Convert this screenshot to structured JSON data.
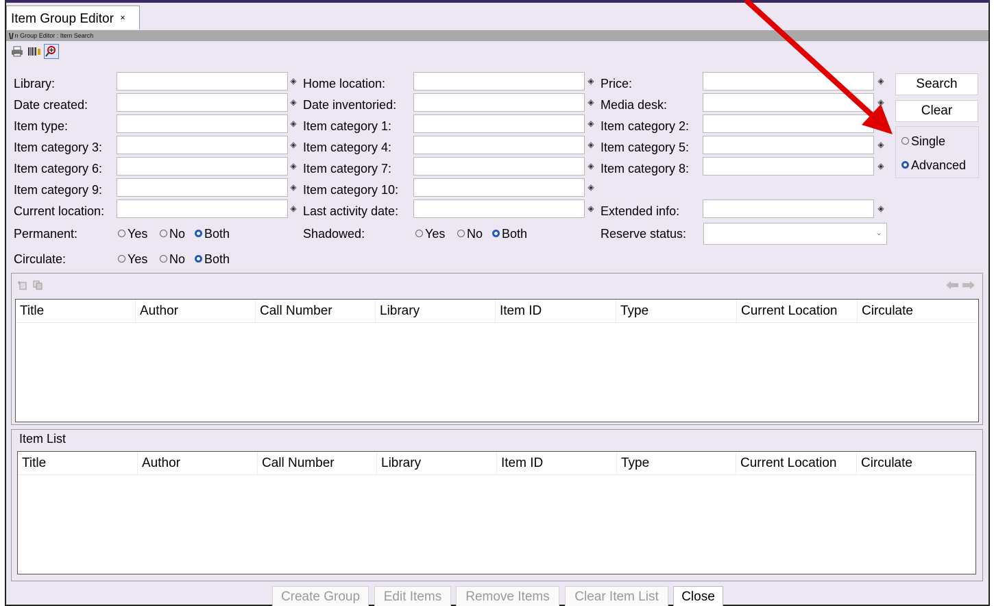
{
  "window": {
    "tab_title": "Item Group Editor",
    "tab_close": "×",
    "breadcrumb_lead": "\\/",
    "breadcrumb": "n Group Editor : Item Search"
  },
  "fields": {
    "library": "Library:",
    "home_location": "Home location:",
    "price": "Price:",
    "date_created": "Date created:",
    "date_inventoried": "Date inventoried:",
    "media_desk": "Media desk:",
    "item_type": "Item type:",
    "item_category_1": "Item category 1:",
    "item_category_2": "Item category 2:",
    "item_category_3": "Item category 3:",
    "item_category_4": "Item category 4:",
    "item_category_5": "Item category 5:",
    "item_category_6": "Item category 6:",
    "item_category_7": "Item category 7:",
    "item_category_8": "Item category 8:",
    "item_category_9": "Item category 9:",
    "item_category_10": "Item category 10:",
    "current_location": "Current location:",
    "last_activity_date": "Last activity date:",
    "extended_info": "Extended info:",
    "permanent": "Permanent:",
    "shadowed": "Shadowed:",
    "reserve_status": "Reserve status:",
    "circulate": "Circulate:",
    "reserve_status_value": ""
  },
  "radio_options": {
    "yes": "Yes",
    "no": "No",
    "both": "Both",
    "selected": "Both"
  },
  "actions": {
    "search": "Search",
    "clear": "Clear"
  },
  "search_mode": {
    "single": "Single",
    "advanced": "Advanced",
    "selected": "Advanced"
  },
  "results_table": {
    "columns": [
      "Title",
      "Author",
      "Call Number",
      "Library",
      "Item ID",
      "Type",
      "Current Location",
      "Circulate"
    ],
    "rows": []
  },
  "item_list": {
    "legend": "Item List",
    "columns": [
      "Title",
      "Author",
      "Call Number",
      "Library",
      "Item ID",
      "Type",
      "Current Location",
      "Circulate"
    ],
    "rows": []
  },
  "bottom_buttons": {
    "create_group": "Create Group",
    "edit_items": "Edit Items",
    "remove_items": "Remove Items",
    "clear_item_list": "Clear Item List",
    "close": "Close"
  },
  "colors": {
    "annotation_arrow": "#e00000",
    "radio_selected": "#1f5bb8",
    "panel_bg": "#ede7f3"
  },
  "icons": [
    "printer-icon",
    "barcode-icon",
    "item-search-icon",
    "spinner-icon",
    "chevron-down-icon",
    "add-row-icon",
    "copy-row-icon",
    "arrow-left-icon",
    "arrow-right-icon"
  ]
}
